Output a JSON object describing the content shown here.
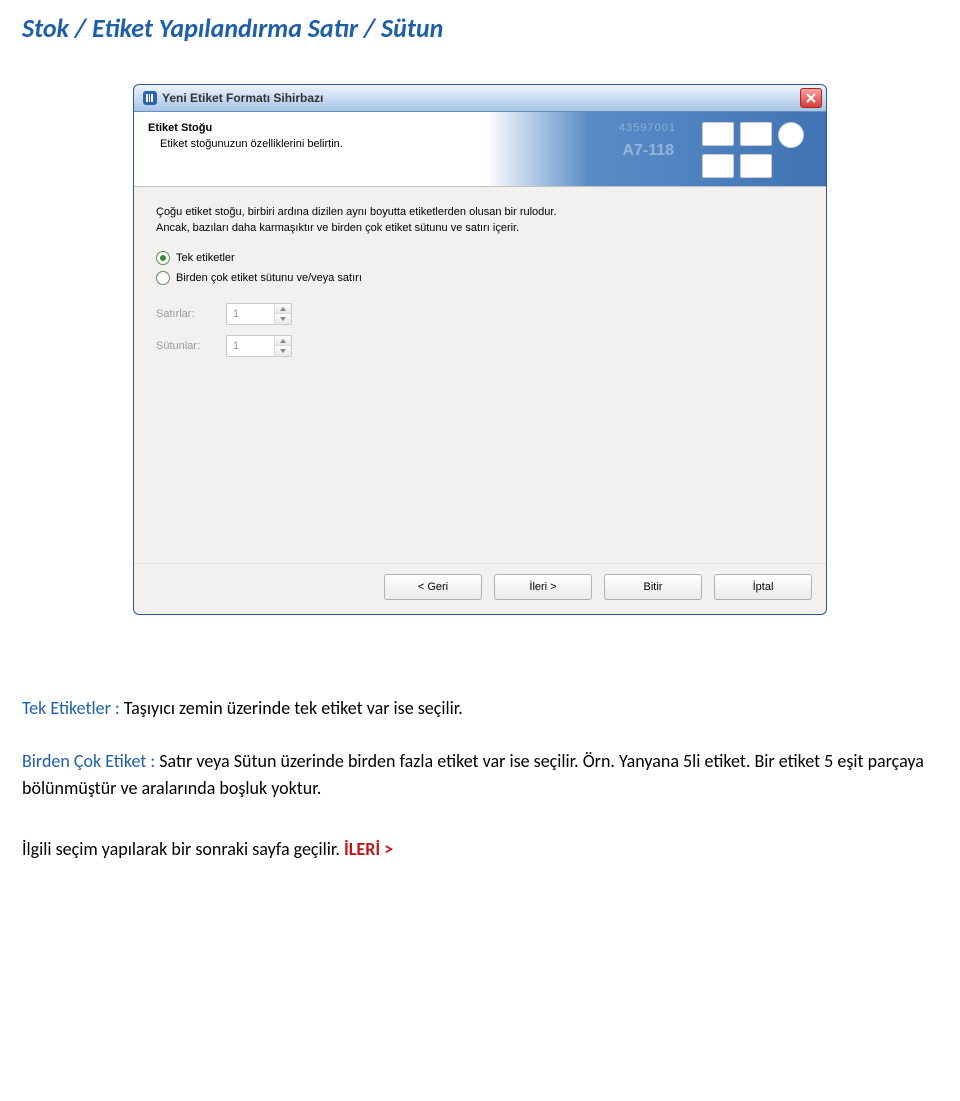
{
  "page_heading": "Stok / Etiket Yapılandırma Satır / Sütun",
  "dialog": {
    "title": "Yeni Etiket Formatı Sihirbazı",
    "header": {
      "title": "Etiket Stoğu",
      "subtitle": "Etiket stoğunuzun özelliklerini belirtin.",
      "deco_number": "43597001",
      "deco_code": "A7-118"
    },
    "description": "Çoğu etiket stoğu, birbiri ardına dizilen aynı boyutta etiketlerden olusan bir rulodur. Ancak, bazıları daha karmaşıktır ve birden çok etiket sütunu ve satırı içerir.",
    "radios": {
      "single": "Tek etiketler",
      "multi": "Birden çok etiket sütunu ve/veya satırı"
    },
    "fields": {
      "rows_label": "Satırlar:",
      "rows_value": "1",
      "cols_label": "Sütunlar:",
      "cols_value": "1"
    },
    "buttons": {
      "back": "<  Geri",
      "next": "İleri  >",
      "finish": "Bitir",
      "cancel": "İptal"
    }
  },
  "post": {
    "p1_lead": "Tek Etiketler :",
    "p1_rest": " Taşıyıcı zemin üzerinde tek etiket var ise seçilir.",
    "p2_lead": "Birden Çok Etiket :",
    "p2_rest": " Satır veya Sütun üzerinde birden fazla etiket var ise seçilir. Örn. Yanyana 5li etiket. Bir etiket 5 eşit parçaya bölünmüştür ve aralarında boşluk yoktur.",
    "p3_text": "İlgili seçim yapılarak bir sonraki sayfa geçilir. ",
    "p3_action": "İLERİ >"
  }
}
